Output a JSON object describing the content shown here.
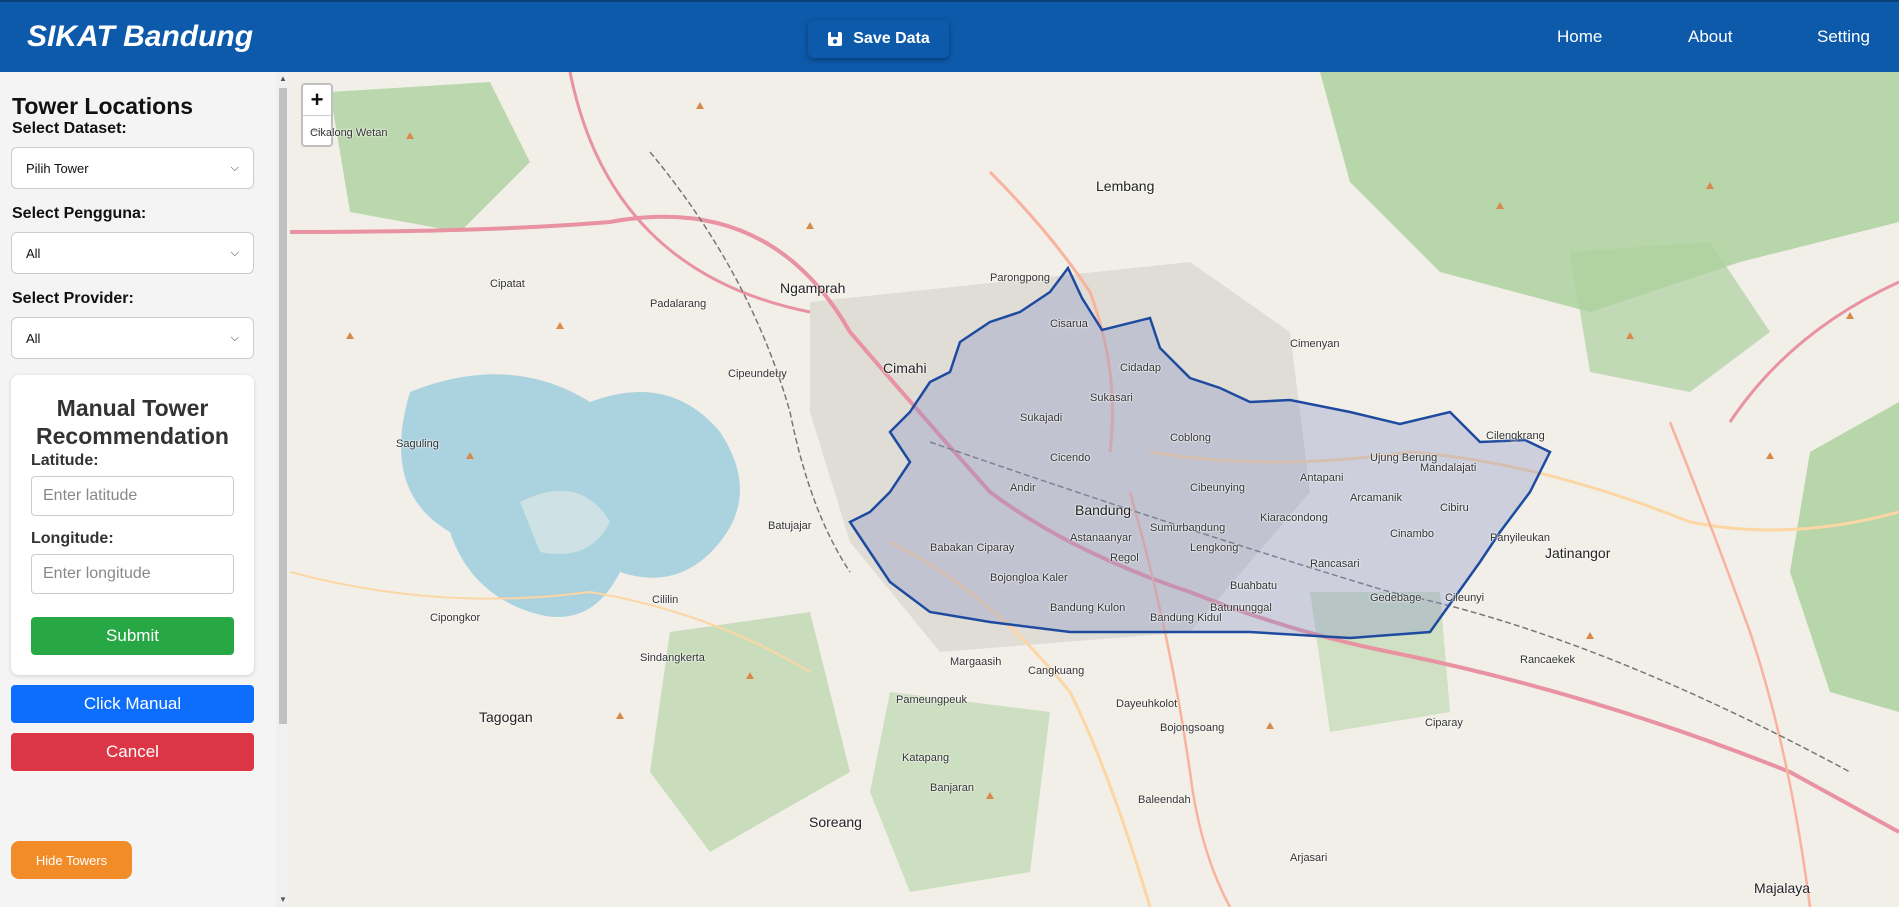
{
  "header": {
    "brand": "SIKAT Bandung",
    "save_label": "Save Data",
    "nav": [
      "Home",
      "About",
      "Setting"
    ]
  },
  "sidebar": {
    "title": "Tower Locations",
    "dataset_label": "Select Dataset:",
    "dataset_value": "Pilih Tower",
    "pengguna_label": "Select Pengguna:",
    "pengguna_value": "All",
    "provider_label": "Select Provider:",
    "provider_value": "All",
    "manual": {
      "title_line1": "Manual Tower",
      "title_line2": "Recommendation",
      "latitude_label": "Latitude:",
      "latitude_placeholder": "Enter latitude",
      "longitude_label": "Longitude:",
      "longitude_placeholder": "Enter longitude",
      "submit_label": "Submit"
    },
    "click_manual_label": "Click Manual",
    "cancel_label": "Cancel",
    "hide_towers_label": "Hide Towers"
  },
  "map": {
    "zoom_in": "+",
    "zoom_out": "−",
    "labels": [
      "Bandung",
      "Cimahi",
      "Lembang",
      "Ngamprah",
      "Soreang",
      "Jatinangor",
      "Tagogan",
      "Majalaya",
      "Dayeuhkolot",
      "Bojongsoang",
      "Ciparay",
      "Banjaran",
      "Cileunyi",
      "Rancaekek",
      "Padalarang",
      "Cisarua",
      "Parongpong",
      "Cimenyan",
      "Cilengkrang",
      "Margaasih",
      "Katapang",
      "Baleendah",
      "Arjasari",
      "Pameungpeuk",
      "Cangkuang",
      "Cikalong Wetan",
      "Cipatat",
      "Cililin",
      "Sindangkerta",
      "Cipongkor",
      "Batujajar",
      "Cipeundeuy",
      "Saguling",
      "Sukajadi",
      "Coblong",
      "Kiaracondong",
      "Antapani",
      "Arcamanik",
      "Ujung Berung",
      "Cibiru",
      "Gedebage",
      "Rancasari",
      "Buahbatu",
      "Bojongloa Kaler",
      "Babakan Ciparay",
      "Cibeunying",
      "Sumurbandung",
      "Andir",
      "Cicendo",
      "Sukasari",
      "Cidadap",
      "Mandalajati",
      "Panyileukan",
      "Cinambo",
      "Regol",
      "Lengkong",
      "Astanaanyar",
      "Batununggal",
      "Bandung Kulon",
      "Bandung Kidul"
    ]
  }
}
